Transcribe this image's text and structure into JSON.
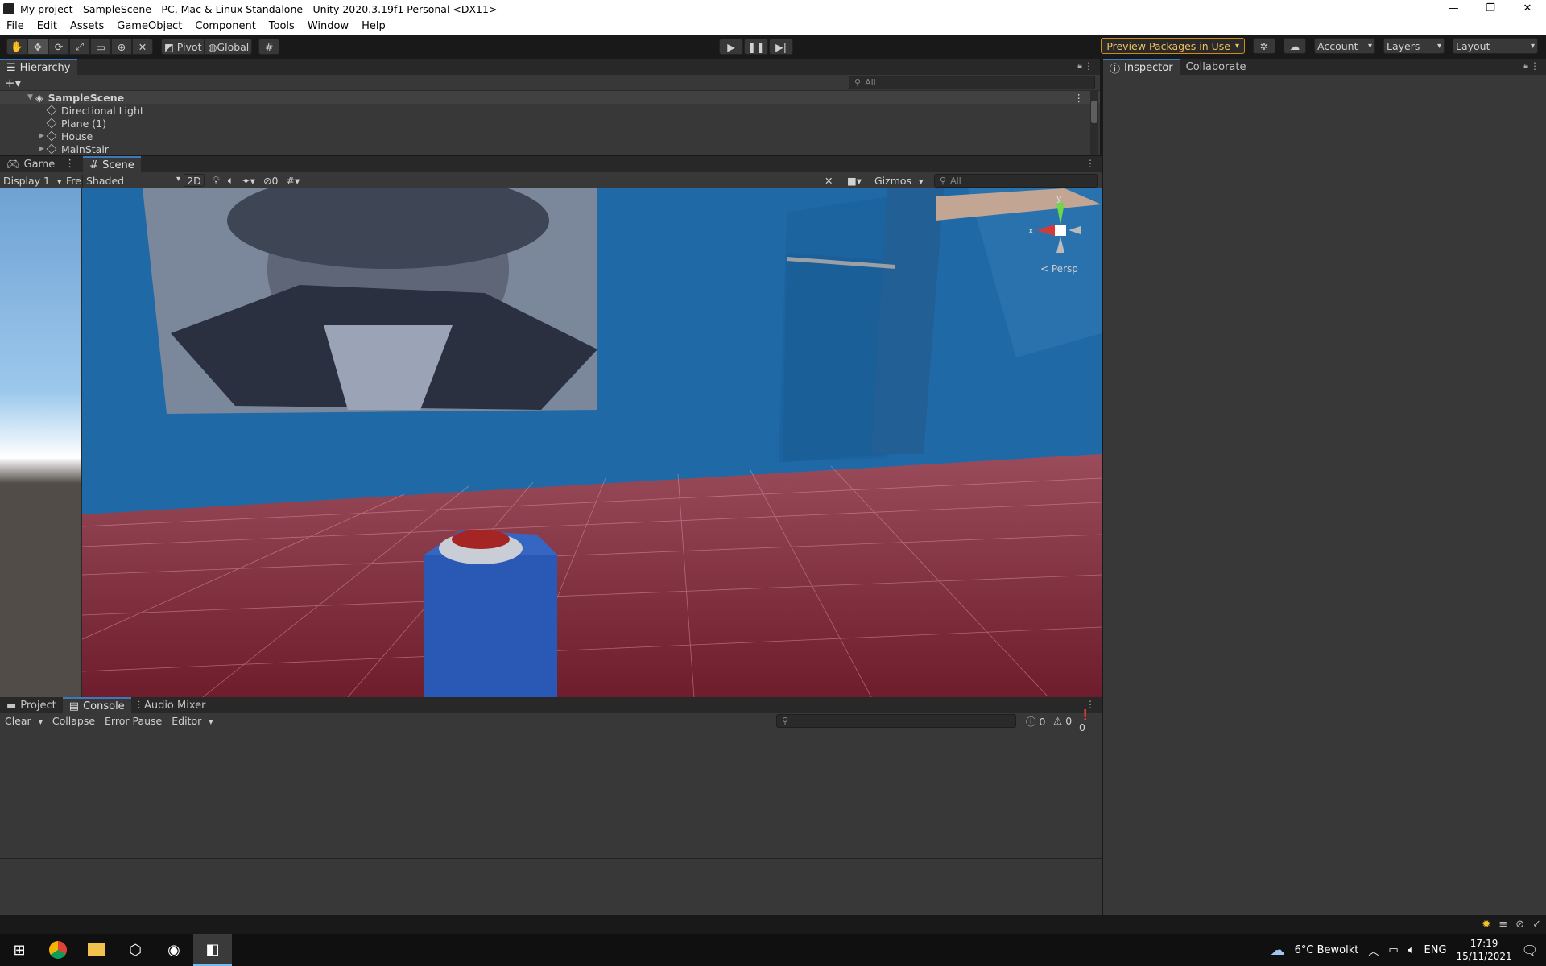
{
  "window": {
    "title": "My project - SampleScene - PC, Mac & Linux Standalone - Unity 2020.3.19f1 Personal <DX11>",
    "minimize": "—",
    "restore": "❐",
    "close": "✕"
  },
  "menu": [
    "File",
    "Edit",
    "Assets",
    "GameObject",
    "Component",
    "Tools",
    "Window",
    "Help"
  ],
  "toolbar": {
    "pivot": "Pivot",
    "global": "Global",
    "preview_packages": "Preview Packages in Use",
    "account": "Account",
    "layers": "Layers",
    "layout": "Layout"
  },
  "hierarchy": {
    "tab": "Hierarchy",
    "search_placeholder": "All",
    "scene": "SampleScene",
    "items": [
      {
        "label": "Directional Light",
        "expandable": false
      },
      {
        "label": "Plane (1)",
        "expandable": false
      },
      {
        "label": "House",
        "expandable": true
      },
      {
        "label": "MainStair",
        "expandable": true
      }
    ]
  },
  "inspector": {
    "tab": "Inspector",
    "tab2": "Collaborate"
  },
  "scene_view": {
    "tabs": {
      "game": "Game",
      "scene": "Scene"
    },
    "display": "Display 1",
    "free": "Fre",
    "shading": "Shaded",
    "mode_2d": "2D",
    "hidden_count": "0",
    "gizmos": "Gizmos",
    "search_placeholder": "All",
    "persp": "Persp",
    "axis_x": "x",
    "axis_y": "y"
  },
  "console": {
    "tabs": {
      "project": "Project",
      "console": "Console",
      "audio": "Audio Mixer"
    },
    "clear": "Clear",
    "collapse": "Collapse",
    "error_pause": "Error Pause",
    "editor": "Editor",
    "log_count": "0",
    "warn_count": "0",
    "error_count": "0"
  },
  "taskbar": {
    "weather": "6°C Bewolkt",
    "lang": "ENG",
    "time": "17:19",
    "date": "15/11/2021"
  },
  "colors": {
    "accent": "#3a79bb",
    "wall": "#1f6aa6",
    "floor": "#8a2a3a",
    "pkg_border": "#d28a12"
  }
}
